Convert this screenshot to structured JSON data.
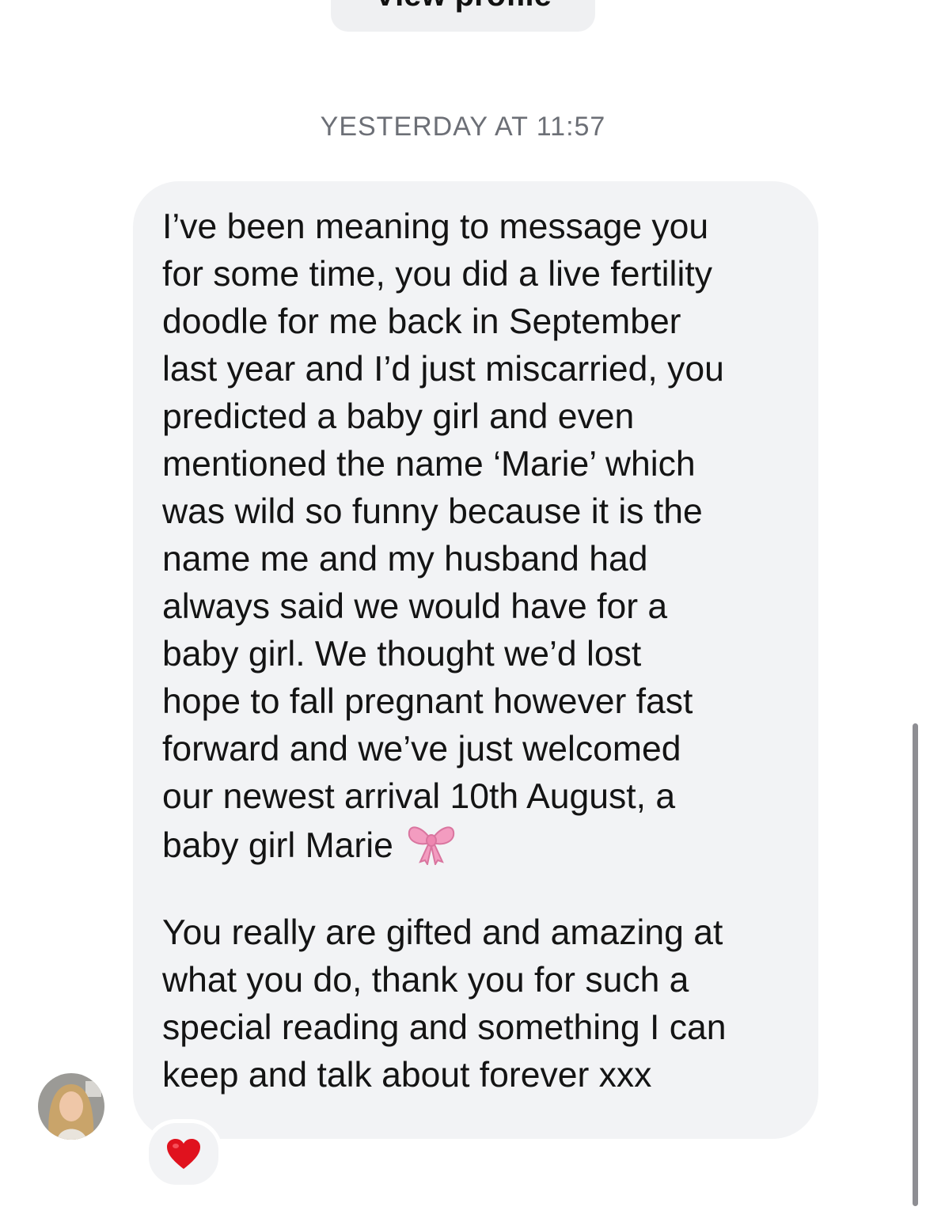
{
  "header": {
    "view_profile_label": "View profile"
  },
  "conversation": {
    "timestamp": "YESTERDAY AT 11:57",
    "message": {
      "paragraph_1": "I’ve been meaning to message you\nfor some time, you did a live fertility\ndoodle for me back in September\nlast year and I’d just miscarried, you\npredicted a baby girl and even\nmentioned the name ‘Marie’ which\nwas wild so funny because it is the\nname me and my husband had\nalways said we would have for a\nbaby girl. We thought we’d lost\nhope to fall pregnant however fast\nforward and we’ve just welcomed\nour newest arrival 10th August, a\nbaby girl Marie ",
      "paragraph_1_emoji": "ribbon-icon",
      "paragraph_2": "You really are gifted and amazing at\nwhat you do, thank you for such a\nspecial reading and something I can\nkeep and talk about forever xxx"
    },
    "sender_avatar": "avatar-icon",
    "reaction": {
      "emoji": "red-heart-icon"
    }
  },
  "colors": {
    "bubble_background": "#f2f3f5",
    "timestamp_text": "#6c6f76",
    "message_text": "#141414",
    "heart": "#e0121e",
    "ribbon": "#f39cc0"
  }
}
